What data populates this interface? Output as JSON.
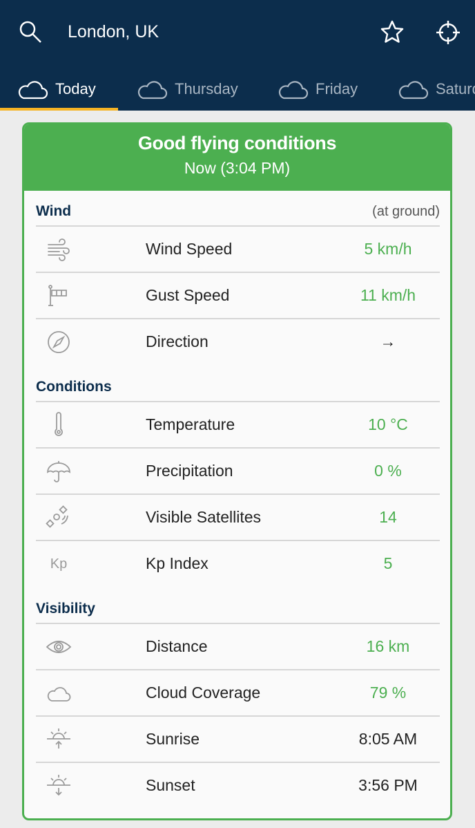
{
  "header": {
    "location": "London, UK",
    "icons": [
      "search-icon",
      "star-icon",
      "locate-icon"
    ]
  },
  "tabs": [
    {
      "label": "Today",
      "icon": "cloud-icon",
      "active": true
    },
    {
      "label": "Thursday",
      "icon": "cloud-icon",
      "active": false
    },
    {
      "label": "Friday",
      "icon": "cloud-icon",
      "active": false
    },
    {
      "label": "Saturday",
      "icon": "cloud-icon",
      "active": false
    }
  ],
  "card": {
    "title": "Good flying conditions",
    "subtitle": "Now (3:04 PM)",
    "accent_color": "#4caf50",
    "sections": [
      {
        "title": "Wind",
        "note": "(at ground)",
        "rows": [
          {
            "icon": "wind-icon",
            "label": "Wind Speed",
            "value": "5 km/h"
          },
          {
            "icon": "windsock-icon",
            "label": "Gust Speed",
            "value": "11 km/h"
          },
          {
            "icon": "compass-icon",
            "label": "Direction",
            "value": "→"
          }
        ]
      },
      {
        "title": "Conditions",
        "note": "",
        "rows": [
          {
            "icon": "thermometer-icon",
            "label": "Temperature",
            "value": "10 °C"
          },
          {
            "icon": "umbrella-icon",
            "label": "Precipitation",
            "value": "0 %"
          },
          {
            "icon": "satellite-icon",
            "label": "Visible Satellites",
            "value": "14"
          },
          {
            "icon": "kp-icon",
            "icon_text": "Kp",
            "label": "Kp Index",
            "value": "5"
          }
        ]
      },
      {
        "title": "Visibility",
        "note": "",
        "rows": [
          {
            "icon": "eye-icon",
            "label": "Distance",
            "value": "16 km"
          },
          {
            "icon": "cloud-icon",
            "label": "Cloud Coverage",
            "value": "79 %"
          },
          {
            "icon": "sunrise-icon",
            "label": "Sunrise",
            "value": "8:05 AM"
          },
          {
            "icon": "sunset-icon",
            "label": "Sunset",
            "value": "3:56 PM"
          }
        ]
      }
    ]
  }
}
